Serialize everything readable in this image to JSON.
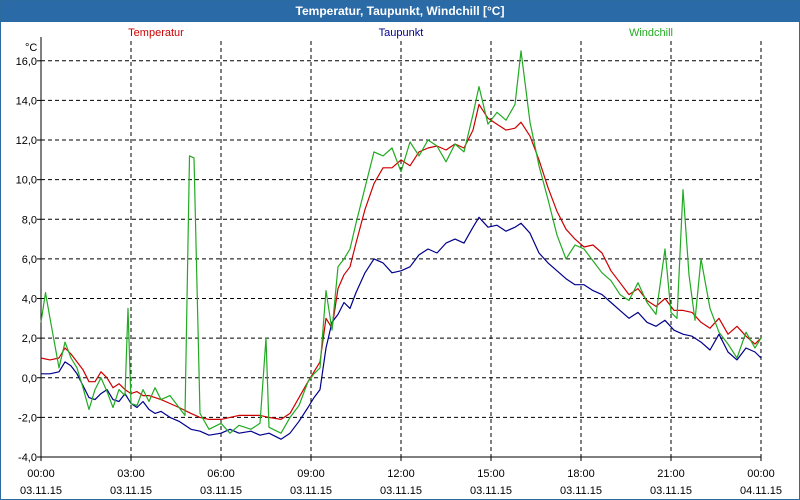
{
  "window": {
    "title": "Temperatur, Taupunkt, Windchill [°C]"
  },
  "colors": {
    "title_bar": "#2a6aa6",
    "grid": "#000000",
    "Temperatur": "#cc0000",
    "Taupunkt": "#00008b",
    "Windchill": "#22aa22"
  },
  "chart_data": {
    "type": "line",
    "title": "Temperatur, Taupunkt, Windchill [°C]",
    "ylabel": "°C",
    "xlabel": "",
    "ylim": [
      -4.0,
      17.0
    ],
    "xlim": [
      0,
      24
    ],
    "grid": true,
    "legend_position": "top",
    "y_ticks": [
      {
        "value": 16,
        "label": "16,0"
      },
      {
        "value": 14,
        "label": "14,0"
      },
      {
        "value": 12,
        "label": "12,0"
      },
      {
        "value": 10,
        "label": "10,0"
      },
      {
        "value": 8,
        "label": "8,0"
      },
      {
        "value": 6,
        "label": "6,0"
      },
      {
        "value": 4,
        "label": "4,0"
      },
      {
        "value": 2,
        "label": "2,0"
      },
      {
        "value": 0,
        "label": "0,0"
      },
      {
        "value": -2,
        "label": "-2,0"
      },
      {
        "value": -4,
        "label": "-4,0"
      }
    ],
    "x_ticks": [
      {
        "value": 0,
        "time": "00:00",
        "date": "03.11.15"
      },
      {
        "value": 3,
        "time": "03:00",
        "date": "03.11.15"
      },
      {
        "value": 6,
        "time": "06:00",
        "date": "03.11.15"
      },
      {
        "value": 9,
        "time": "09:00",
        "date": "03.11.15"
      },
      {
        "value": 12,
        "time": "12:00",
        "date": "03.11.15"
      },
      {
        "value": 15,
        "time": "15:00",
        "date": "03.11.15"
      },
      {
        "value": 18,
        "time": "18:00",
        "date": "03.11.15"
      },
      {
        "value": 21,
        "time": "21:00",
        "date": "03.11.15"
      },
      {
        "value": 24,
        "time": "00:00",
        "date": "04.11.15"
      }
    ],
    "series": [
      {
        "name": "Temperatur",
        "color": "#cc0000",
        "points": [
          [
            0,
            1.0
          ],
          [
            0.3,
            0.9
          ],
          [
            0.6,
            1.0
          ],
          [
            0.8,
            1.5
          ],
          [
            1.0,
            1.2
          ],
          [
            1.2,
            0.8
          ],
          [
            1.4,
            0.4
          ],
          [
            1.6,
            -0.2
          ],
          [
            1.8,
            -0.2
          ],
          [
            2.0,
            0.3
          ],
          [
            2.2,
            0.0
          ],
          [
            2.4,
            -0.5
          ],
          [
            2.6,
            -0.3
          ],
          [
            2.8,
            -0.6
          ],
          [
            3.0,
            -0.8
          ],
          [
            3.2,
            -0.7
          ],
          [
            3.4,
            -0.9
          ],
          [
            3.6,
            -0.9
          ],
          [
            3.8,
            -1.0
          ],
          [
            4.0,
            -1.1
          ],
          [
            4.3,
            -1.3
          ],
          [
            4.6,
            -1.5
          ],
          [
            5.0,
            -1.8
          ],
          [
            5.3,
            -2.0
          ],
          [
            5.6,
            -2.1
          ],
          [
            6.0,
            -2.1
          ],
          [
            6.3,
            -2.0
          ],
          [
            6.6,
            -1.9
          ],
          [
            7.0,
            -1.9
          ],
          [
            7.3,
            -1.9
          ],
          [
            7.6,
            -2.0
          ],
          [
            8.0,
            -2.1
          ],
          [
            8.3,
            -1.8
          ],
          [
            8.6,
            -1.0
          ],
          [
            8.9,
            -0.2
          ],
          [
            9.1,
            0.3
          ],
          [
            9.3,
            0.8
          ],
          [
            9.5,
            3.0
          ],
          [
            9.7,
            2.5
          ],
          [
            9.9,
            4.5
          ],
          [
            10.1,
            5.2
          ],
          [
            10.3,
            5.6
          ],
          [
            10.5,
            6.8
          ],
          [
            10.8,
            8.5
          ],
          [
            11.1,
            9.8
          ],
          [
            11.4,
            10.6
          ],
          [
            11.7,
            10.6
          ],
          [
            12.0,
            11.0
          ],
          [
            12.3,
            10.7
          ],
          [
            12.6,
            11.4
          ],
          [
            12.9,
            11.6
          ],
          [
            13.2,
            11.7
          ],
          [
            13.5,
            11.5
          ],
          [
            13.8,
            11.8
          ],
          [
            14.1,
            11.6
          ],
          [
            14.4,
            12.5
          ],
          [
            14.6,
            13.8
          ],
          [
            14.9,
            13.1
          ],
          [
            15.2,
            12.8
          ],
          [
            15.5,
            12.5
          ],
          [
            15.8,
            12.6
          ],
          [
            16.0,
            12.9
          ],
          [
            16.3,
            12.2
          ],
          [
            16.6,
            11.0
          ],
          [
            16.9,
            9.6
          ],
          [
            17.2,
            8.4
          ],
          [
            17.5,
            7.5
          ],
          [
            17.8,
            7.0
          ],
          [
            18.1,
            6.6
          ],
          [
            18.4,
            6.7
          ],
          [
            18.7,
            6.3
          ],
          [
            19.0,
            5.4
          ],
          [
            19.3,
            4.8
          ],
          [
            19.6,
            4.2
          ],
          [
            19.9,
            4.5
          ],
          [
            20.2,
            3.9
          ],
          [
            20.5,
            3.6
          ],
          [
            20.8,
            4.0
          ],
          [
            21.1,
            3.4
          ],
          [
            21.4,
            3.4
          ],
          [
            21.7,
            3.3
          ],
          [
            22.0,
            2.8
          ],
          [
            22.3,
            2.5
          ],
          [
            22.6,
            3.0
          ],
          [
            22.9,
            2.2
          ],
          [
            23.2,
            2.6
          ],
          [
            23.5,
            2.1
          ],
          [
            23.8,
            1.7
          ],
          [
            24.0,
            2.0
          ]
        ]
      },
      {
        "name": "Taupunkt",
        "color": "#00008b",
        "points": [
          [
            0,
            0.2
          ],
          [
            0.3,
            0.2
          ],
          [
            0.6,
            0.3
          ],
          [
            0.8,
            0.8
          ],
          [
            1.0,
            0.6
          ],
          [
            1.2,
            0.2
          ],
          [
            1.4,
            -0.4
          ],
          [
            1.6,
            -1.0
          ],
          [
            1.8,
            -1.1
          ],
          [
            2.0,
            -0.8
          ],
          [
            2.2,
            -0.6
          ],
          [
            2.4,
            -1.1
          ],
          [
            2.6,
            -1.2
          ],
          [
            2.8,
            -0.8
          ],
          [
            3.0,
            -1.3
          ],
          [
            3.2,
            -1.5
          ],
          [
            3.4,
            -1.2
          ],
          [
            3.6,
            -1.6
          ],
          [
            3.8,
            -1.8
          ],
          [
            4.0,
            -1.7
          ],
          [
            4.3,
            -2.0
          ],
          [
            4.6,
            -2.2
          ],
          [
            5.0,
            -2.6
          ],
          [
            5.3,
            -2.7
          ],
          [
            5.6,
            -2.9
          ],
          [
            6.0,
            -2.8
          ],
          [
            6.3,
            -2.6
          ],
          [
            6.6,
            -2.8
          ],
          [
            7.0,
            -2.7
          ],
          [
            7.3,
            -2.9
          ],
          [
            7.6,
            -2.8
          ],
          [
            8.0,
            -3.1
          ],
          [
            8.3,
            -2.8
          ],
          [
            8.6,
            -2.2
          ],
          [
            8.9,
            -1.5
          ],
          [
            9.1,
            -1.0
          ],
          [
            9.3,
            -0.6
          ],
          [
            9.5,
            1.5
          ],
          [
            9.7,
            2.8
          ],
          [
            9.9,
            3.2
          ],
          [
            10.1,
            3.8
          ],
          [
            10.3,
            3.5
          ],
          [
            10.5,
            4.3
          ],
          [
            10.8,
            5.3
          ],
          [
            11.1,
            6.0
          ],
          [
            11.4,
            5.8
          ],
          [
            11.7,
            5.3
          ],
          [
            12.0,
            5.4
          ],
          [
            12.3,
            5.6
          ],
          [
            12.6,
            6.2
          ],
          [
            12.9,
            6.5
          ],
          [
            13.2,
            6.3
          ],
          [
            13.5,
            6.8
          ],
          [
            13.8,
            7.0
          ],
          [
            14.1,
            6.8
          ],
          [
            14.4,
            7.6
          ],
          [
            14.6,
            8.1
          ],
          [
            14.9,
            7.6
          ],
          [
            15.2,
            7.7
          ],
          [
            15.5,
            7.4
          ],
          [
            15.8,
            7.6
          ],
          [
            16.0,
            7.8
          ],
          [
            16.3,
            7.3
          ],
          [
            16.6,
            6.3
          ],
          [
            16.9,
            5.8
          ],
          [
            17.2,
            5.4
          ],
          [
            17.5,
            5.0
          ],
          [
            17.8,
            4.7
          ],
          [
            18.1,
            4.7
          ],
          [
            18.4,
            4.4
          ],
          [
            18.7,
            4.2
          ],
          [
            19.0,
            3.8
          ],
          [
            19.3,
            3.4
          ],
          [
            19.6,
            3.0
          ],
          [
            19.9,
            3.3
          ],
          [
            20.2,
            2.8
          ],
          [
            20.5,
            2.6
          ],
          [
            20.8,
            2.9
          ],
          [
            21.1,
            2.4
          ],
          [
            21.4,
            2.2
          ],
          [
            21.7,
            2.1
          ],
          [
            22.0,
            1.8
          ],
          [
            22.3,
            1.4
          ],
          [
            22.6,
            2.2
          ],
          [
            22.9,
            1.3
          ],
          [
            23.2,
            0.9
          ],
          [
            23.5,
            1.5
          ],
          [
            23.8,
            1.3
          ],
          [
            24.0,
            1.0
          ]
        ]
      },
      {
        "name": "Windchill",
        "color": "#22aa22",
        "points": [
          [
            0,
            2.8
          ],
          [
            0.15,
            4.3
          ],
          [
            0.3,
            3.0
          ],
          [
            0.6,
            0.5
          ],
          [
            0.8,
            1.8
          ],
          [
            1.0,
            1.0
          ],
          [
            1.2,
            0.5
          ],
          [
            1.4,
            -0.5
          ],
          [
            1.6,
            -1.6
          ],
          [
            1.8,
            -0.6
          ],
          [
            2.0,
            0.0
          ],
          [
            2.2,
            -0.7
          ],
          [
            2.4,
            -1.5
          ],
          [
            2.6,
            -0.6
          ],
          [
            2.8,
            -0.9
          ],
          [
            2.9,
            3.5
          ],
          [
            3.0,
            -1.3
          ],
          [
            3.2,
            -1.4
          ],
          [
            3.4,
            -0.6
          ],
          [
            3.6,
            -1.2
          ],
          [
            3.8,
            -0.5
          ],
          [
            4.0,
            -1.1
          ],
          [
            4.3,
            -0.9
          ],
          [
            4.6,
            -1.5
          ],
          [
            4.8,
            -1.9
          ],
          [
            4.95,
            11.2
          ],
          [
            5.1,
            11.1
          ],
          [
            5.3,
            -1.8
          ],
          [
            5.6,
            -2.6
          ],
          [
            6.0,
            -2.3
          ],
          [
            6.3,
            -2.8
          ],
          [
            6.6,
            -2.4
          ],
          [
            7.0,
            -2.6
          ],
          [
            7.3,
            -2.3
          ],
          [
            7.5,
            2.0
          ],
          [
            7.6,
            -2.5
          ],
          [
            8.0,
            -2.8
          ],
          [
            8.3,
            -2.0
          ],
          [
            8.6,
            -1.4
          ],
          [
            8.9,
            -0.2
          ],
          [
            9.1,
            0.2
          ],
          [
            9.3,
            0.5
          ],
          [
            9.5,
            4.4
          ],
          [
            9.7,
            2.4
          ],
          [
            9.9,
            5.6
          ],
          [
            10.1,
            6.0
          ],
          [
            10.3,
            6.5
          ],
          [
            10.5,
            7.8
          ],
          [
            10.8,
            9.6
          ],
          [
            11.1,
            11.4
          ],
          [
            11.4,
            11.2
          ],
          [
            11.7,
            11.6
          ],
          [
            12.0,
            10.4
          ],
          [
            12.3,
            11.9
          ],
          [
            12.6,
            11.2
          ],
          [
            12.9,
            12.0
          ],
          [
            13.2,
            11.7
          ],
          [
            13.5,
            10.9
          ],
          [
            13.8,
            11.8
          ],
          [
            14.1,
            11.4
          ],
          [
            14.4,
            13.3
          ],
          [
            14.6,
            14.7
          ],
          [
            14.9,
            12.8
          ],
          [
            15.2,
            13.4
          ],
          [
            15.5,
            13.0
          ],
          [
            15.8,
            13.8
          ],
          [
            16.0,
            16.5
          ],
          [
            16.3,
            12.9
          ],
          [
            16.6,
            10.7
          ],
          [
            16.9,
            9.0
          ],
          [
            17.2,
            7.2
          ],
          [
            17.5,
            6.0
          ],
          [
            17.8,
            6.7
          ],
          [
            18.1,
            6.5
          ],
          [
            18.4,
            5.9
          ],
          [
            18.7,
            5.3
          ],
          [
            19.0,
            4.9
          ],
          [
            19.3,
            4.2
          ],
          [
            19.6,
            3.9
          ],
          [
            19.9,
            4.8
          ],
          [
            20.2,
            3.8
          ],
          [
            20.5,
            3.2
          ],
          [
            20.8,
            6.5
          ],
          [
            21.0,
            3.3
          ],
          [
            21.2,
            3.0
          ],
          [
            21.4,
            9.5
          ],
          [
            21.6,
            5.2
          ],
          [
            21.8,
            2.9
          ],
          [
            22.0,
            6.0
          ],
          [
            22.3,
            3.5
          ],
          [
            22.6,
            2.3
          ],
          [
            22.9,
            1.7
          ],
          [
            23.2,
            1.0
          ],
          [
            23.5,
            2.3
          ],
          [
            23.8,
            1.5
          ],
          [
            24.0,
            2.0
          ]
        ]
      }
    ]
  }
}
